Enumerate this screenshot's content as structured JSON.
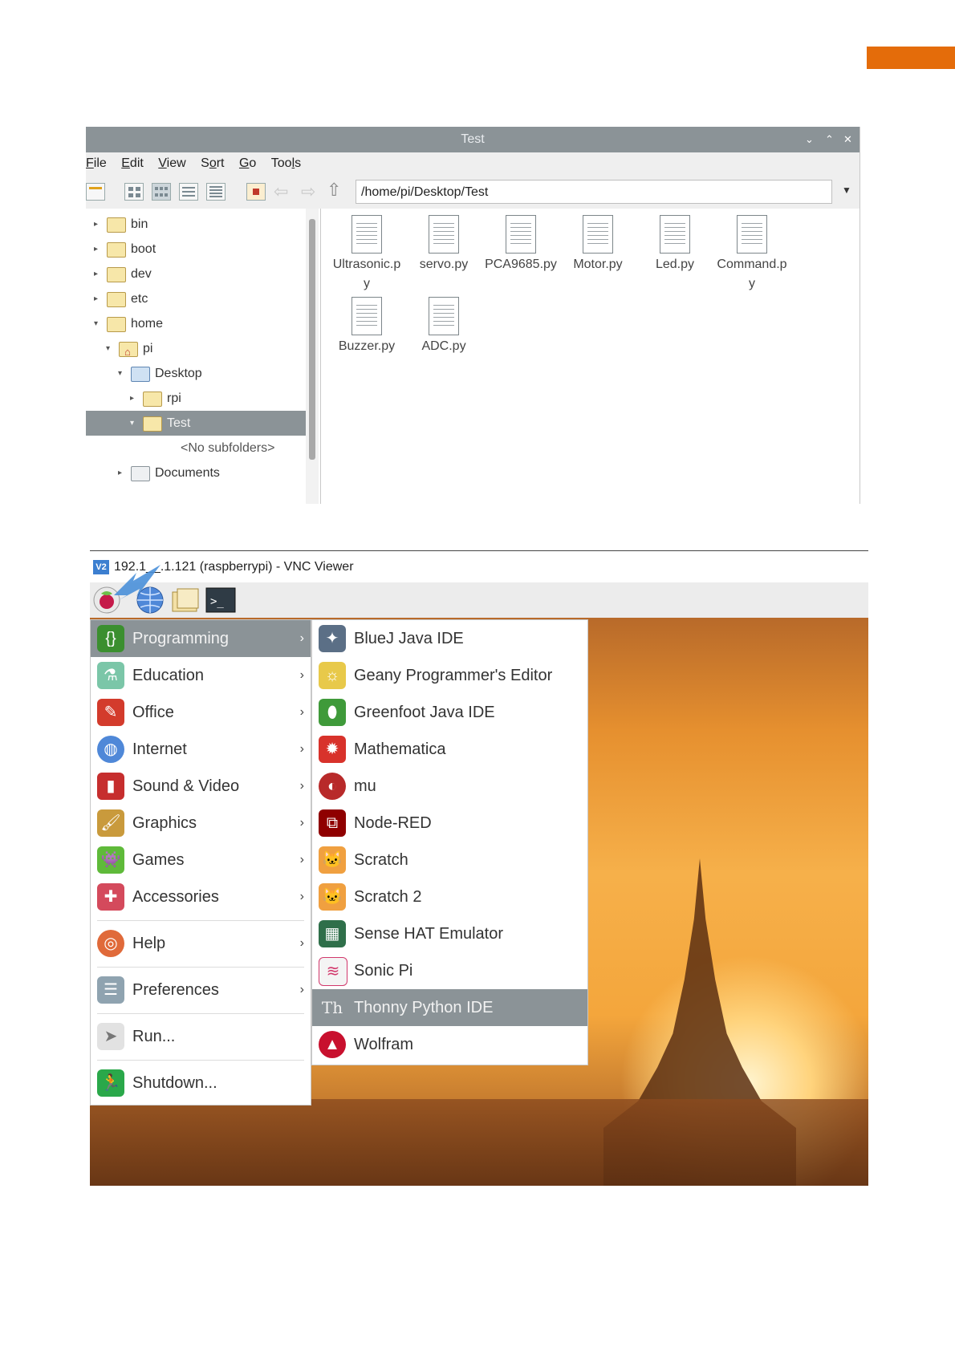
{
  "file_manager": {
    "title": "Test",
    "menu": [
      "File",
      "Edit",
      "View",
      "Sort",
      "Go",
      "Tools"
    ],
    "path": "/home/pi/Desktop/Test",
    "tree": [
      {
        "label": "bin",
        "expanded": false
      },
      {
        "label": "boot",
        "expanded": false
      },
      {
        "label": "dev",
        "expanded": false
      },
      {
        "label": "etc",
        "expanded": false
      },
      {
        "label": "home",
        "expanded": true
      },
      {
        "label": "pi",
        "expanded": true
      },
      {
        "label": "Desktop",
        "expanded": true
      },
      {
        "label": "rpi",
        "expanded": false
      },
      {
        "label": "Test",
        "expanded": true,
        "selected": true
      },
      {
        "label": "<No subfolders>"
      },
      {
        "label": "Documents",
        "expanded": false
      }
    ],
    "files": [
      "Ultrasonic.py",
      "servo.py",
      "PCA9685.py",
      "Motor.py",
      "Led.py",
      "Command.py",
      "Buzzer.py",
      "ADC.py"
    ],
    "file_lines": [
      [
        "Ultrasonic.p",
        "y"
      ],
      [
        "servo.py"
      ],
      [
        "PCA9685.py"
      ],
      [
        "Motor.py"
      ],
      [
        "Led.py"
      ],
      [
        "Command.p",
        "y"
      ],
      [
        "Buzzer.py"
      ],
      [
        "ADC.py"
      ]
    ]
  },
  "vnc": {
    "logo": "V2",
    "title": "192.1__.1.121 (raspberrypi) - VNC Viewer"
  },
  "main_menu": {
    "items": [
      {
        "label": "Programming",
        "selected": true,
        "submenu": true
      },
      {
        "label": "Education",
        "submenu": true
      },
      {
        "label": "Office",
        "submenu": true
      },
      {
        "label": "Internet",
        "submenu": true
      },
      {
        "label": "Sound & Video",
        "submenu": true
      },
      {
        "label": "Graphics",
        "submenu": true
      },
      {
        "label": "Games",
        "submenu": true
      },
      {
        "label": "Accessories",
        "submenu": true
      },
      {
        "label": "Help",
        "submenu": true
      },
      {
        "label": "Preferences",
        "submenu": true
      },
      {
        "label": "Run...",
        "submenu": false
      },
      {
        "label": "Shutdown...",
        "submenu": false
      }
    ]
  },
  "programming_menu": {
    "items": [
      {
        "label": "BlueJ Java IDE"
      },
      {
        "label": "Geany Programmer's Editor"
      },
      {
        "label": "Greenfoot Java IDE"
      },
      {
        "label": "Mathematica"
      },
      {
        "label": "mu"
      },
      {
        "label": "Node-RED"
      },
      {
        "label": "Scratch"
      },
      {
        "label": "Scratch 2"
      },
      {
        "label": "Sense HAT Emulator"
      },
      {
        "label": "Sonic Pi"
      },
      {
        "label": "Thonny Python IDE",
        "selected": true
      },
      {
        "label": "Wolfram"
      }
    ]
  },
  "colors": {
    "accent_orange": "#e46c0a",
    "selection_gray": "#8b9397"
  }
}
